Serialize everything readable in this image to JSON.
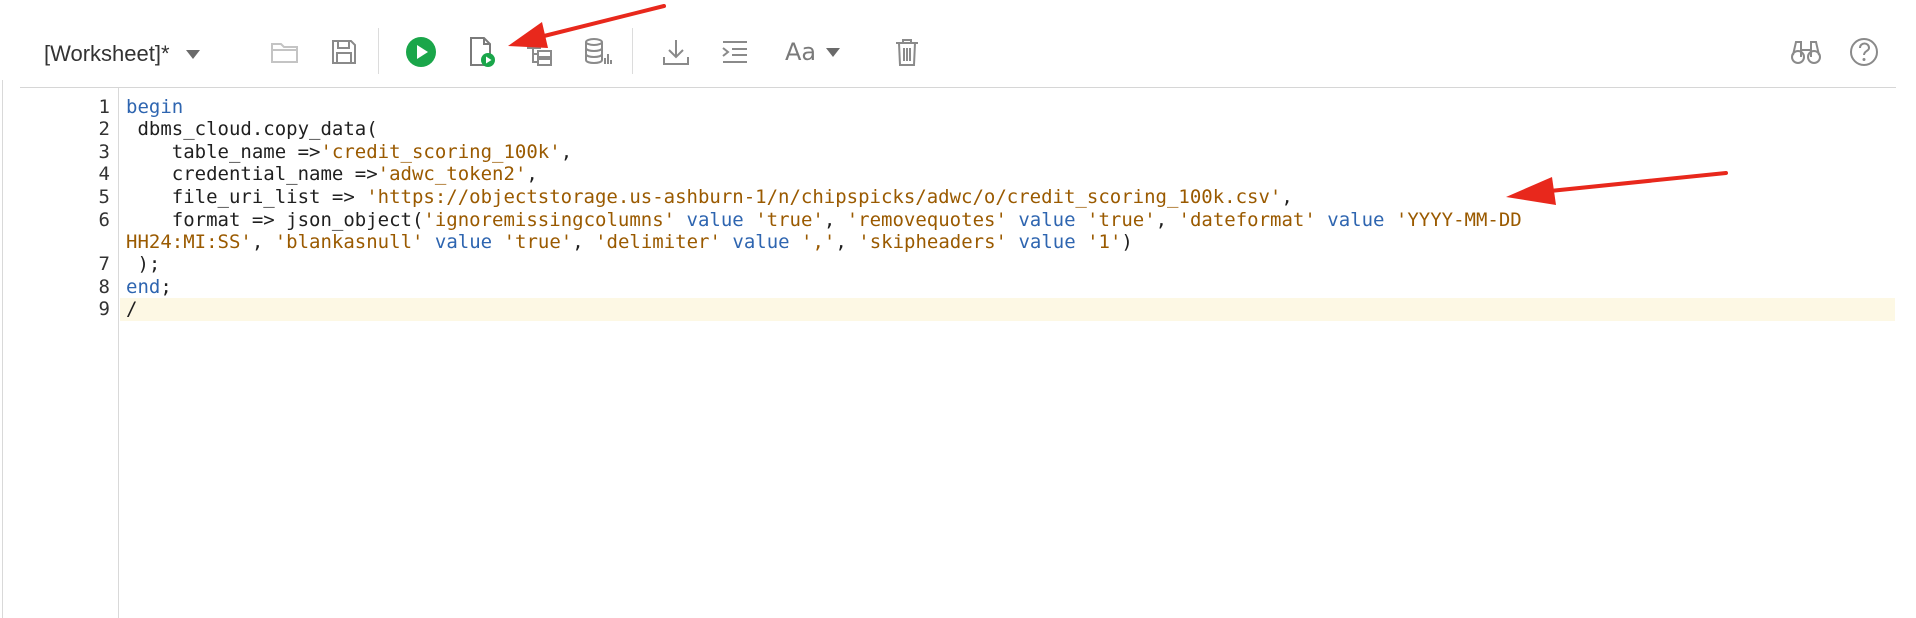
{
  "toolbar": {
    "worksheet_label": "[Worksheet]*",
    "font_label": "Aa",
    "icons": [
      "folder-open-icon",
      "save-icon",
      "run-statement-icon",
      "run-script-icon",
      "explain-plan-icon",
      "autotrace-icon",
      "download-icon",
      "format-icon",
      "font-size-icon",
      "delete-icon",
      "find-icon",
      "help-icon"
    ]
  },
  "editor": {
    "line_numbers": [
      "1",
      "2",
      "3",
      "4",
      "5",
      "6",
      "7",
      "8",
      "9"
    ],
    "lines": {
      "l1": {
        "kw": "begin"
      },
      "l2": {
        "text": " dbms_cloud.copy_data("
      },
      "l3": {
        "pre": "    table_name =>",
        "str": "'credit_scoring_100k'",
        "post": ","
      },
      "l4": {
        "pre": "    credential_name =>",
        "str": "'adwc_token2'",
        "post": ","
      },
      "l5": {
        "pre": "    file_uri_list => ",
        "str": "'https://objectstorage.us-ashburn-1/n/chipspicks/adwc/o/credit_scoring_100k.csv'",
        "post": ","
      },
      "l6": {
        "pre": "    format => json_object(",
        "s1": "'ignoremissingcolumns'",
        "v1": "value",
        "s2": "'true'",
        "s3": "'removequotes'",
        "v2": "value",
        "s4": "'true'",
        "s5": "'dateformat'",
        "v3": "value",
        "s6": "'YYYY-MM-DD"
      },
      "l6b": {
        "s1": "HH24:MI:SS'",
        "s2": "'blankasnull'",
        "v1": "value",
        "s3": "'true'",
        "s4": "'delimiter'",
        "v2": "value",
        "s5": "','",
        "s6": "'skipheaders'",
        "v3": "value",
        "s7": "'1'",
        "post": ")"
      },
      "l7": {
        "text": " );"
      },
      "l8": {
        "kw": "end",
        "post": ";"
      },
      "l9": {
        "text": "/"
      }
    }
  },
  "colors": {
    "keyword": "#2e65b0",
    "string": "#9a5a00",
    "run_green": "#1aa64a",
    "arrow_red": "#e8281c"
  }
}
